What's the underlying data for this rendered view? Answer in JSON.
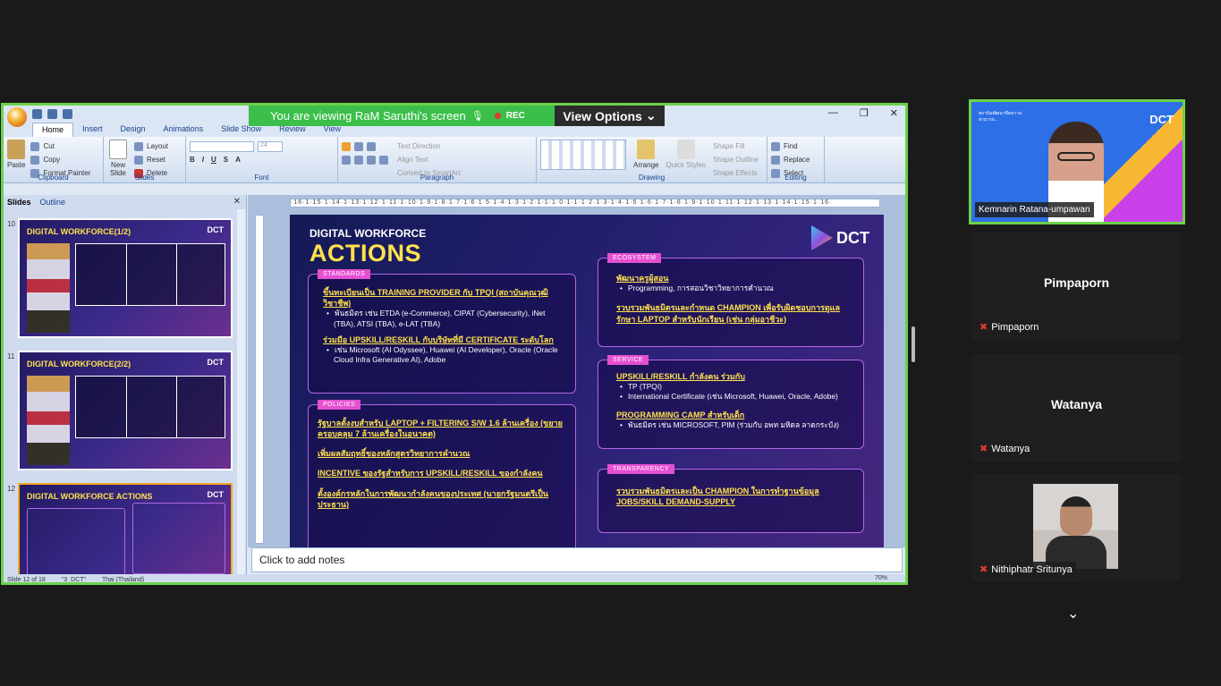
{
  "share": {
    "banner_text": "You are viewing  RaM Saruthi's screen",
    "rec_label": "REC",
    "view_options": "View Options"
  },
  "ppt": {
    "tabs": [
      "Home",
      "Insert",
      "Design",
      "Animations",
      "Slide Show",
      "Review",
      "View"
    ],
    "clipboard": {
      "paste": "Paste",
      "cut": "Cut",
      "copy": "Copy",
      "format_painter": "Format Painter",
      "group": "Clipboard"
    },
    "slides_group": {
      "new_slide": "New Slide",
      "layout": "Layout",
      "reset": "Reset",
      "delete": "Delete",
      "group": "Slides"
    },
    "font_group": {
      "font_size": "24",
      "group": "Font"
    },
    "paragraph_group": {
      "text_direction": "Text Direction",
      "align_text": "Align Text",
      "convert": "Convert to SmartArt",
      "group": "Paragraph"
    },
    "drawing_group": {
      "arrange": "Arrange",
      "quick_styles": "Quick Styles",
      "shape_fill": "Shape Fill",
      "shape_outline": "Shape Outline",
      "shape_effects": "Shape Effects",
      "group": "Drawing"
    },
    "editing_group": {
      "find": "Find",
      "replace": "Replace",
      "select": "Select",
      "group": "Editing"
    },
    "panel_tabs": {
      "slides": "Slides",
      "outline": "Outline"
    },
    "thumbnails": [
      {
        "num": "10",
        "title": "DIGITAL WORKFORCE(1/2)",
        "logo": "DCT"
      },
      {
        "num": "11",
        "title": "DIGITAL WORKFORCE(2/2)",
        "logo": "DCT"
      },
      {
        "num": "12",
        "title": "DIGITAL WORKFORCE ACTIONS",
        "logo": "DCT"
      }
    ],
    "notes_placeholder": "Click to add notes",
    "status": {
      "slide": "Slide 12 of 18",
      "theme": "\"3_DCT\"",
      "language": "Thai (Thailand)",
      "zoom": "70%"
    },
    "ruler": "·16·1·15·1·14·1·13·1·12·1·11·1·10·1·9·1·8·1·7·1·6·1·5·1·4·1·3·1·2·1·1·1·0·1·1·1·2·1·3·1·4·1·5·1·6·1·7·1·8·1·9·1·10·1·11·1·12·1·13·1·14·1·15·1·16·"
  },
  "slide": {
    "subtitle": "DIGITAL WORKFORCE",
    "title": "ACTIONS",
    "logo": "DCT",
    "standards": {
      "tag": "STANDARDS",
      "p1": "ขึ้นทะเบียนเป็น TRAINING PROVIDER กับ TPQI (สถาบันคุณวุฒิวิชาชีพ)",
      "b1": "พันธมิตร เช่น ETDA (e-Commerce), CIPAT (Cybersecurity), iNet (TBA), ATSI (TBA), e-LAT (TBA)",
      "p2": "ร่วมมือ UPSKILL/RESKILL กับบริษัทที่มี CERTIFICATE ระดับโลก",
      "b2": "เช่น Microsoft (AI Odyssee), Huawei (AI Developer), Oracle (Oracle Cloud Infra Generative AI), Adobe"
    },
    "policies": {
      "tag": "POLICIES",
      "p1": "รัฐบาลตั้งงบสำหรับ LAPTOP + FILTERING S/W 1.6 ล้านเครื่อง (ขยายครอบคลุม 7 ล้านเครื่องในอนาคต)",
      "p2": "เพิ่มผลสัมฤทธิ์ของหลักสูตรวิทยาการคำนวณ",
      "p3": "INCENTIVE ของรัฐสำหรับการ UPSKILL/RESKILL ของกำลังคน",
      "p4": "ตั้งองค์กรหลักในการพัฒนากำลังคนของประเทศ (นายกรัฐมนตรีเป็นประธาน)"
    },
    "ecosystem": {
      "tag": "ECOSYSTEM",
      "p1": "พัฒนาครูผู้สอน",
      "b1": "Programming, การสอนวิชาวิทยาการคำนวณ",
      "p2": "รวบรวมพันธมิตรและกำหนด CHAMPION เพื่อรับผิดชอบการดูแลรักษา LAPTOP สำหรับนักเรียน (เช่น กลุ่มอาชีวะ)"
    },
    "service": {
      "tag": "SERVICE",
      "p1": "UPSKILL/RESKILL กำลังคน ร่วมกับ",
      "b1": "TP (TPQI)",
      "b2": "International Certificate (เช่น Microsoft, Huawei, Oracle, Adobe)",
      "p2": "PROGRAMMING CAMP สำหรับเด็ก",
      "b3": "พันธมิตร เช่น MICROSOFT, PIM (ร่วมกับ อพท มหิดล ลาดกระบัง)"
    },
    "transparency": {
      "tag": "TRANSPARENCY",
      "p1": "รวบรวมพันธมิตรและเป็น CHAMPION ในการทำฐานข้อมูล JOBS/SKILL DEMAND-SUPPLY"
    }
  },
  "participants": {
    "active": {
      "name": "Kemnarin Ratana-umpawan",
      "org": "สถาบันพัฒนาขีดความสามารถ...",
      "logo": "DCT"
    },
    "others": [
      {
        "display": "Pimpaporn",
        "label": "Pimpaporn"
      },
      {
        "display": "Watanya",
        "label": "Watanya"
      },
      {
        "display": "",
        "label": "Nithiphatr Sritunya"
      }
    ]
  }
}
